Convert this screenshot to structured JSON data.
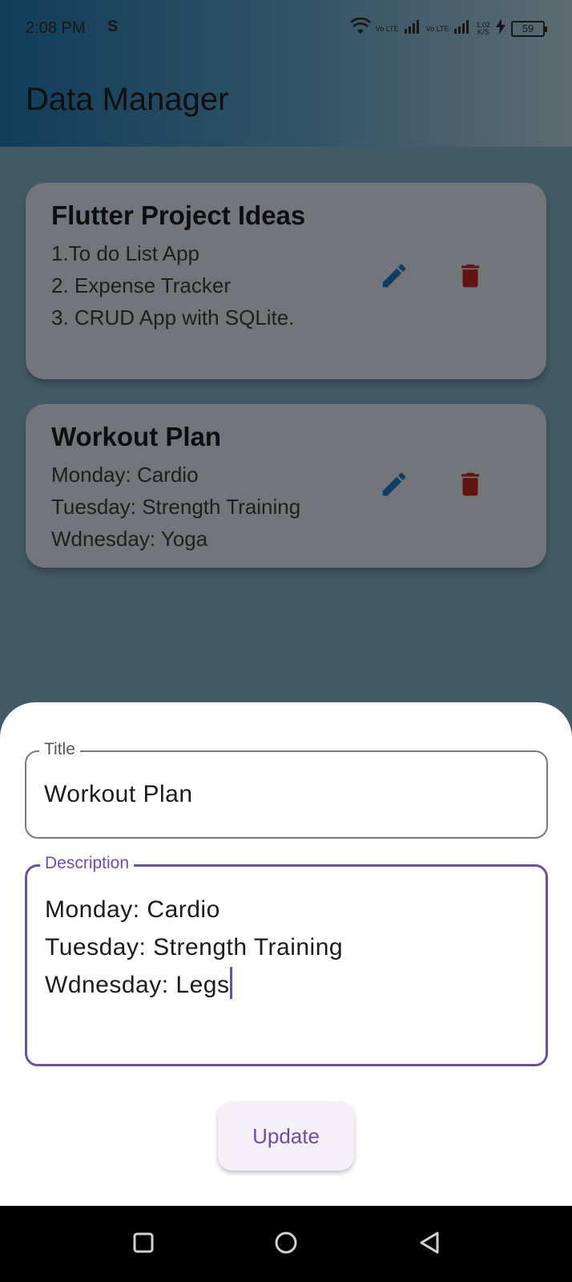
{
  "status_bar": {
    "time": "2:08 PM",
    "carrier_icon": "S",
    "lte1": "Vo LTE",
    "lte2": "Vo LTE",
    "speed_value": "1.02",
    "speed_unit": "K/S",
    "battery": "59"
  },
  "app_bar": {
    "title": "Data Manager"
  },
  "notes": [
    {
      "title": "Flutter Project Ideas",
      "lines": [
        "1.To do List App",
        "2. Expense Tracker",
        "3. CRUD App with SQLite."
      ]
    },
    {
      "title": "Workout Plan",
      "lines": [
        "Monday: Cardio",
        "Tuesday: Strength Training",
        "Wdnesday: Yoga"
      ]
    }
  ],
  "sheet": {
    "title_label": "Title",
    "title_value": "Workout Plan",
    "description_label": "Description",
    "description_lines": [
      "Monday: Cardio",
      "Tuesday: Strength Training",
      "Wdnesday: Legs"
    ],
    "update_label": "Update"
  },
  "colors": {
    "accent": "#6a4fa3",
    "edit_icon": "#1f6fb3",
    "delete_icon": "#b3261e"
  },
  "icons": {
    "edit": "pencil-icon",
    "delete": "trash-icon",
    "nav_recent": "square-icon",
    "nav_home": "circle-icon",
    "nav_back": "triangle-back-icon"
  }
}
